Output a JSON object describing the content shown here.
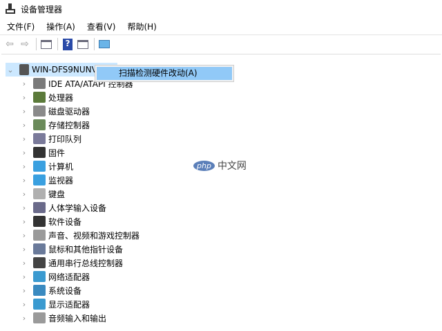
{
  "window": {
    "title": "设备管理器"
  },
  "menu": [
    "文件(F)",
    "操作(A)",
    "查看(V)",
    "帮助(H)"
  ],
  "toolbar": {
    "icons": [
      "back-arrow-icon",
      "forward-arrow-icon",
      "show-hide-console-tree-icon",
      "help-icon",
      "action-pane-icon",
      "scan-hardware-icon"
    ]
  },
  "tree": {
    "root": "WIN-DFS9NUNV69K",
    "items": [
      {
        "label": "IDE ATA/ATAPI 控制器",
        "icon": "ide-controller-icon",
        "color": "#7a7a7a"
      },
      {
        "label": "处理器",
        "icon": "processor-icon",
        "color": "#5b7a3a"
      },
      {
        "label": "磁盘驱动器",
        "icon": "disk-drive-icon",
        "color": "#8a8a8a"
      },
      {
        "label": "存储控制器",
        "icon": "storage-controller-icon",
        "color": "#6a8a5a"
      },
      {
        "label": "打印队列",
        "icon": "printer-icon",
        "color": "#7a7a9a"
      },
      {
        "label": "固件",
        "icon": "firmware-icon",
        "color": "#333333"
      },
      {
        "label": "计算机",
        "icon": "computer-icon",
        "color": "#3aa0e0"
      },
      {
        "label": "监视器",
        "icon": "monitor-icon",
        "color": "#3aa0e0"
      },
      {
        "label": "键盘",
        "icon": "keyboard-icon",
        "color": "#b0b0b0"
      },
      {
        "label": "人体学输入设备",
        "icon": "hid-icon",
        "color": "#6a6a8a"
      },
      {
        "label": "软件设备",
        "icon": "software-device-icon",
        "color": "#333333"
      },
      {
        "label": "声音、视频和游戏控制器",
        "icon": "speaker-icon",
        "color": "#9a9a9a"
      },
      {
        "label": "鼠标和其他指针设备",
        "icon": "mouse-icon",
        "color": "#6a7a9a"
      },
      {
        "label": "通用串行总线控制器",
        "icon": "usb-icon",
        "color": "#444444"
      },
      {
        "label": "网络适配器",
        "icon": "network-adapter-icon",
        "color": "#3a9ad0"
      },
      {
        "label": "系统设备",
        "icon": "system-device-icon",
        "color": "#3a8ac0"
      },
      {
        "label": "显示适配器",
        "icon": "display-adapter-icon",
        "color": "#3a9ad0"
      },
      {
        "label": "音频输入和输出",
        "icon": "audio-io-icon",
        "color": "#9a9a9a"
      }
    ]
  },
  "context_menu": {
    "item": "扫描检测硬件改动(A)"
  },
  "watermark": {
    "logo": "php",
    "text": "中文网"
  }
}
